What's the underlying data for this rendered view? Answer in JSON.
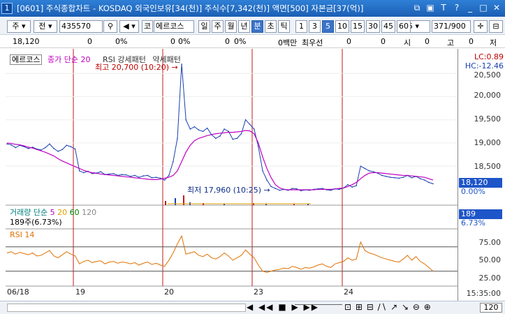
{
  "title": {
    "number": "1",
    "text": "[0601] 주식종합차트 - KOSDAQ 외국인보유[34(천)] 주식수[7,342(천)] 액면[500] 자본금[37(억)]"
  },
  "toolbar": {
    "type_select": "주",
    "period_label": "전",
    "code": "435570",
    "market_badge": "코",
    "stock_name": "에르코스",
    "periods": [
      "일",
      "주",
      "월",
      "년",
      "분",
      "초",
      "틱"
    ],
    "selected_period": "분",
    "minutes": [
      "1",
      "3",
      "5",
      "10",
      "15",
      "30",
      "45",
      "60"
    ],
    "selected_minute": "5",
    "count_select": "5",
    "range_value": "371",
    "range_total": "/900"
  },
  "info": {
    "price": "18,120",
    "v1": "0",
    "v2": "0%",
    "v3": "0",
    "v4": "0%",
    "v5": "0",
    "v6": "0%",
    "v7": "0백만",
    "prio_label": "최우선",
    "v8": "0",
    "v9": "0",
    "label_si": "시",
    "v10": "0",
    "label_go": "고",
    "v11": "0",
    "label_jeo": "저"
  },
  "price_panel": {
    "legend_name": "에르코스",
    "legend_ma": "종가 단순 20",
    "legend_rsi": "RSI 강세패턴",
    "legend_rsi_weak": "약세패턴",
    "high_annot": "최고 20,700 (10:20)",
    "low_annot": "최저 17,960 (10:25)",
    "lc": "LC:0.89",
    "hc": "HC:-12.46",
    "current_price": "18,120",
    "current_pct": "0.00%",
    "y_ticks": [
      "20,500",
      "20,000",
      "19,500",
      "19,000",
      "18,500"
    ],
    "y_range": [
      17900,
      20850
    ]
  },
  "volume_panel": {
    "legend": "거래량 단순",
    "ma": [
      "5",
      "20",
      "60",
      "120"
    ],
    "sub": "189주(6.73%)",
    "current": "189",
    "pct": "6.73%"
  },
  "rsi_panel": {
    "legend": "RSI 14",
    "ticks": [
      "75.00",
      "50.00",
      "25.00"
    ]
  },
  "x_axis": {
    "dates": [
      "06/18",
      "19",
      "20",
      "23",
      "24"
    ],
    "time": "15:35:00"
  },
  "bottom": {
    "zoom_label": "120"
  },
  "chart_data": {
    "type": "line",
    "price": [
      18980,
      18960,
      18900,
      18950,
      18920,
      18880,
      18910,
      18870,
      18850,
      18900,
      18980,
      18880,
      18820,
      18860,
      18950,
      18920,
      18870,
      18400,
      18360,
      18390,
      18340,
      18350,
      18380,
      18320,
      18330,
      18340,
      18300,
      18320,
      18310,
      18280,
      18300,
      18260,
      18290,
      18300,
      18250,
      18260,
      18240,
      18200,
      18300,
      18600,
      19100,
      20700,
      19500,
      19300,
      19350,
      19280,
      19250,
      19320,
      19180,
      19100,
      19150,
      19300,
      19250,
      19080,
      19100,
      19200,
      19500,
      19400,
      19300,
      18920,
      18400,
      18200,
      18060,
      18020,
      17980,
      18000,
      17980,
      18020,
      18010,
      17970,
      17990,
      17980,
      18000,
      18010,
      18020,
      17990,
      17980,
      18010,
      18000,
      18030,
      18100,
      18050,
      18080,
      18500,
      18450,
      18400,
      18380,
      18350,
      18300,
      18280,
      18260,
      18250,
      18240,
      18260,
      18300,
      18250,
      18280,
      18230,
      18200,
      18150,
      18120
    ],
    "ma20": [
      19000,
      18990,
      18970,
      18960,
      18940,
      18910,
      18890,
      18860,
      18830,
      18800,
      18760,
      18720,
      18660,
      18610,
      18570,
      18530,
      18490,
      18450,
      18410,
      18380,
      18360,
      18350,
      18330,
      18320,
      18310,
      18300,
      18290,
      18280,
      18270,
      18260,
      18250,
      18240,
      18230,
      18220,
      18210,
      18210,
      18220,
      18240,
      18260,
      18300,
      18400,
      18600,
      18800,
      18950,
      19050,
      19100,
      19130,
      19160,
      19180,
      19200,
      19210,
      19220,
      19230,
      19230,
      19240,
      19250,
      19270,
      19260,
      19200,
      19000,
      18700,
      18450,
      18250,
      18100,
      18030,
      18000,
      17990,
      17990,
      17990,
      17990,
      17990,
      17990,
      17990,
      18000,
      18000,
      18000,
      18000,
      18010,
      18020,
      18030,
      18060,
      18100,
      18150,
      18230,
      18300,
      18350,
      18360,
      18360,
      18350,
      18340,
      18330,
      18320,
      18310,
      18300,
      18300,
      18290,
      18280,
      18270,
      18260,
      18230,
      18200
    ],
    "rsi": [
      60,
      62,
      58,
      61,
      59,
      57,
      60,
      55,
      56,
      60,
      64,
      55,
      52,
      57,
      62,
      58,
      55,
      42,
      46,
      48,
      44,
      46,
      47,
      42,
      45,
      46,
      43,
      45,
      44,
      42,
      44,
      40,
      43,
      45,
      41,
      43,
      40,
      38,
      48,
      60,
      75,
      88,
      58,
      60,
      62,
      56,
      54,
      58,
      52,
      50,
      54,
      60,
      55,
      48,
      52,
      56,
      65,
      58,
      52,
      40,
      30,
      28,
      30,
      32,
      33,
      35,
      34,
      38,
      36,
      33,
      36,
      35,
      37,
      40,
      42,
      38,
      36,
      42,
      44,
      46,
      52,
      48,
      50,
      78,
      64,
      60,
      58,
      55,
      52,
      50,
      48,
      46,
      45,
      50,
      56,
      48,
      54,
      46,
      42,
      36,
      30
    ],
    "ylim": [
      17900,
      20850
    ],
    "rsi_ylim": [
      10,
      95
    ]
  }
}
